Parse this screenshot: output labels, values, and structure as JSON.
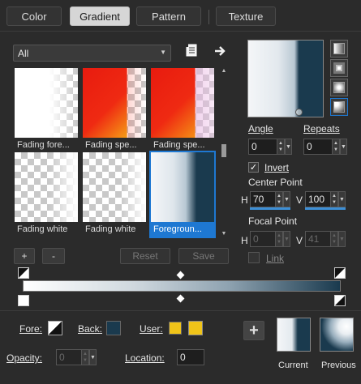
{
  "tabs": [
    {
      "label": "Color",
      "active": false
    },
    {
      "label": "Gradient",
      "active": true
    },
    {
      "label": "Pattern",
      "active": false
    },
    {
      "label": "Texture",
      "active": false
    }
  ],
  "library": {
    "filter": "All",
    "items": [
      {
        "label": "Fading fore..."
      },
      {
        "label": "Fading spe..."
      },
      {
        "label": "Fading spe..."
      },
      {
        "label": "Fading white"
      },
      {
        "label": "Fading white"
      },
      {
        "label": "Foregroun..."
      }
    ],
    "selected_index": 5
  },
  "buttons": {
    "add": "+",
    "remove": "-",
    "reset": "Reset",
    "save": "Save",
    "add_color": "+"
  },
  "angle": {
    "label": "Angle",
    "value": "0"
  },
  "repeats": {
    "label": "Repeats",
    "value": "0"
  },
  "invert": {
    "label": "Invert",
    "checked": true
  },
  "center_point": {
    "label": "Center Point",
    "h_label": "H",
    "h_value": "70",
    "v_label": "V",
    "v_value": "100"
  },
  "focal_point": {
    "label": "Focal Point",
    "h_label": "H",
    "h_value": "0",
    "v_label": "V",
    "v_value": "41"
  },
  "link": {
    "label": "Link"
  },
  "stops": {
    "fore_label": "Fore:",
    "back_label": "Back:",
    "user_label": "User:",
    "opacity_label": "Opacity:",
    "opacity_value": "0",
    "location_label": "Location:",
    "location_value": "0"
  },
  "previews": {
    "current": "Current",
    "previous": "Previous"
  },
  "colors": {
    "accent": "#1e78d2",
    "dark_navy": "#1a3a4e",
    "user_yellow": "#f0c419",
    "panel": "#2b2b2b"
  }
}
